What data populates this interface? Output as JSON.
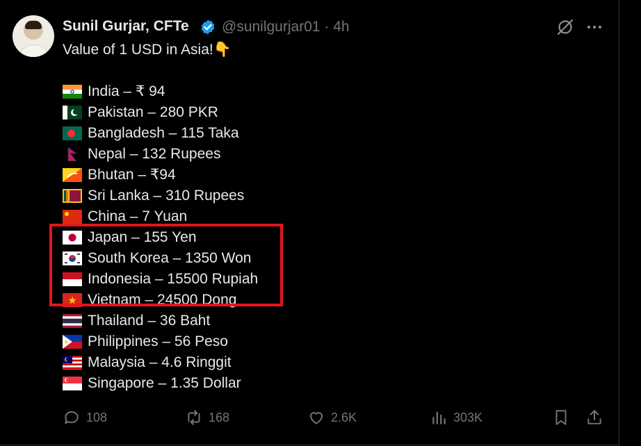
{
  "post": {
    "author_name": "Sunil Gurjar, CFTe",
    "handle_time": "@sunilgurjar01 · 4h",
    "headline": "Value of 1 USD in Asia!👇",
    "items": [
      {
        "text": "India – ₹ 94",
        "flag": "india-flag"
      },
      {
        "text": "Pakistan – 280 PKR",
        "flag": "pakistan-flag"
      },
      {
        "text": "Bangladesh – 115 Taka",
        "flag": "bangladesh-flag"
      },
      {
        "text": "Nepal – 132 Rupees",
        "flag": "nepal-flag"
      },
      {
        "text": "Bhutan – ₹94",
        "flag": "bhutan-flag"
      },
      {
        "text": "Sri Lanka – 310 Rupees",
        "flag": "sri-lanka-flag"
      },
      {
        "text": "China – 7 Yuan",
        "flag": "china-flag"
      },
      {
        "text": "Japan – 155 Yen",
        "flag": "japan-flag"
      },
      {
        "text": "South Korea – 1350 Won",
        "flag": "south-korea-flag"
      },
      {
        "text": "Indonesia – 15500 Rupiah",
        "flag": "indonesia-flag"
      },
      {
        "text": "Vietnam – 24500 Dong",
        "flag": "vietnam-flag"
      },
      {
        "text": "Thailand – 36 Baht",
        "flag": "thailand-flag"
      },
      {
        "text": "Philippines – 56 Peso",
        "flag": "philippines-flag"
      },
      {
        "text": "Malaysia – 4.6 Ringgit",
        "flag": "malaysia-flag"
      },
      {
        "text": "Singapore – 1.35 Dollar",
        "flag": "singapore-flag"
      }
    ]
  },
  "actions": {
    "replies": "108",
    "reposts": "168",
    "likes": "2.6K",
    "views": "303K"
  },
  "colors": {
    "background": "#000000",
    "text": "#e7e9ea",
    "muted": "#71767b",
    "verified": "#1d9bf0",
    "highlight_box": "#e3151b"
  }
}
